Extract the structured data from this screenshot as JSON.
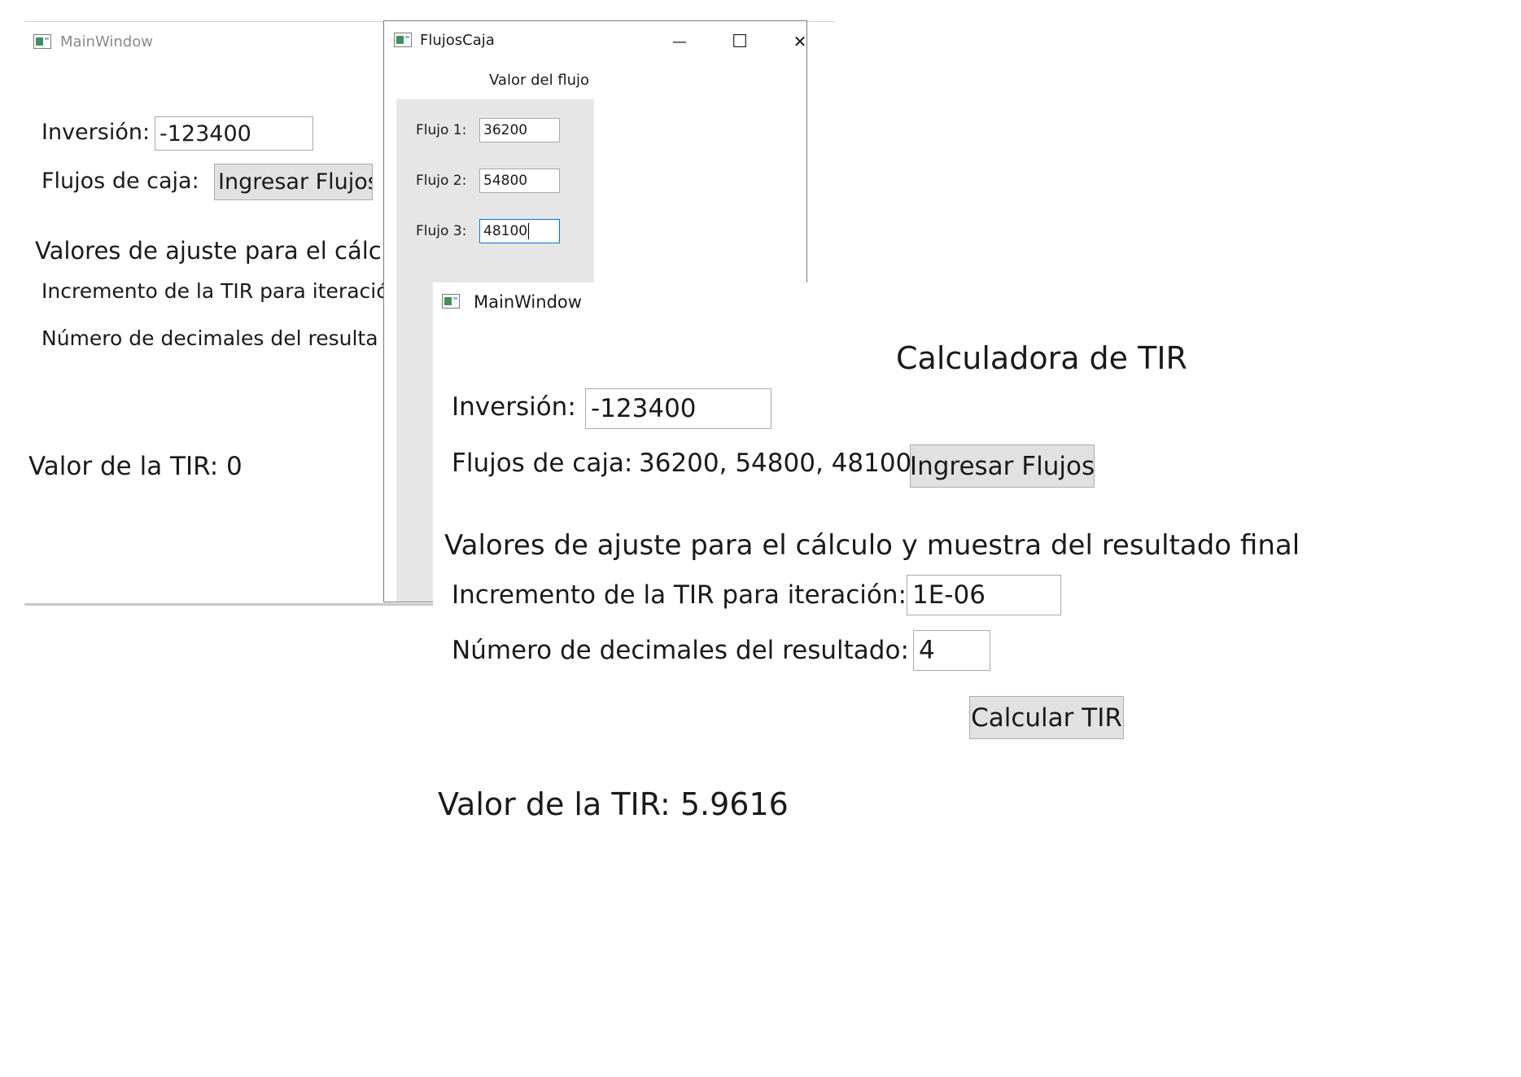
{
  "back_window": {
    "title": "MainWindow",
    "inversion_label": "Inversión:",
    "inversion_value": "-123400",
    "flujos_label": "Flujos de caja:",
    "ingresar_button": "Ingresar Flujos",
    "ajuste_heading": "Valores de ajuste para el cálcu",
    "incremento_label": "Incremento de la TIR para iteració",
    "decimales_label": "Número de decimales del resulta",
    "resultado_label": "Valor de la TIR: 0"
  },
  "flujos_window": {
    "title": "FlujosCaja",
    "header": "Valor del flujo",
    "rows": [
      {
        "label": "Flujo 1:",
        "value": "36200"
      },
      {
        "label": "Flujo 2:",
        "value": "54800"
      },
      {
        "label": "Flujo 3:",
        "value": "48100"
      }
    ],
    "minimize_glyph": "—",
    "maximize_glyph": "☐",
    "close_glyph": "✕"
  },
  "front_window": {
    "title": "MainWindow",
    "heading": "Calculadora de TIR",
    "inversion_label": "Inversión:",
    "inversion_value": "-123400",
    "flujos_label": "Flujos de caja:",
    "flujos_value": "36200, 54800, 48100",
    "ingresar_button": "Ingresar Flujos",
    "ajuste_heading": "Valores de ajuste para el cálculo y muestra del resultado final",
    "incremento_label": "Incremento de la TIR para iteración:",
    "incremento_value": "1E-06",
    "decimales_label": "Número de decimales del resultado:",
    "decimales_value": "4",
    "calcular_button": "Calcular TIR",
    "resultado_label": "Valor de la TIR: 5.9616"
  },
  "colors": {
    "button_bg": "#e1e1e1",
    "panel_bg": "#e6e6e6",
    "focus_border": "#0078d7",
    "icon_green": "#3f8f5f"
  }
}
